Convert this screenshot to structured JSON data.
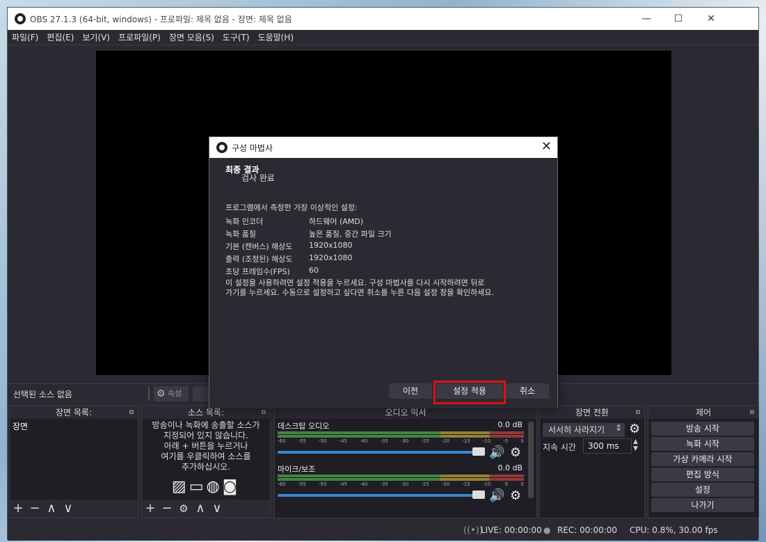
{
  "window": {
    "title": "OBS 27.1.3 (64-bit, windows) - 프로파일: 제목 없음 - 장면: 제목 없음"
  },
  "window_controls": {
    "minimize": "—",
    "maximize": "☐",
    "close": "✕"
  },
  "menu": [
    "파일(F)",
    "편집(E)",
    "보기(V)",
    "프로파일(P)",
    "장면 모음(S)",
    "도구(T)",
    "도움말(H)"
  ],
  "source_bar": {
    "selected": "선택된 소스 없음",
    "properties": "속성"
  },
  "docks": {
    "scenes": {
      "title": "장면 목록:",
      "items": [
        "장면"
      ]
    },
    "sources": {
      "title": "소스 목록:",
      "empty_lines": [
        "방송이나 녹화에 송출할 소스가",
        "지정되어 있지 않습니다.",
        "아래 + 버튼을 누르거나",
        "여기를 우클릭하여 소스를",
        "추가하십시오."
      ]
    },
    "mixer": {
      "title": "오디오 믹서",
      "scale": [
        "-60",
        "-55",
        "-50",
        "-45",
        "-40",
        "-35",
        "-30",
        "-25",
        "-20",
        "-15",
        "-10",
        "-5",
        "0"
      ],
      "channels": [
        {
          "name": "데스크탑 오디오",
          "db": "0.0 dB",
          "volume": 1.0
        },
        {
          "name": "마이크/보조",
          "db": "0.0 dB",
          "volume": 1.0
        }
      ]
    },
    "transitions": {
      "title": "장면 전환",
      "selected": "서서히 사라지기",
      "duration_label": "지속 시간",
      "duration": "300 ms"
    },
    "controls": {
      "title": "제어",
      "buttons": [
        "방송 시작",
        "녹화 시작",
        "가상 카메라 시작",
        "편집 방식",
        "설정",
        "나가기"
      ]
    }
  },
  "status": {
    "live": "LIVE: 00:00:00",
    "rec": "REC: 00:00:00",
    "cpu": "CPU: 0.8%, 30.00 fps"
  },
  "dialog": {
    "title": "구성 마법사",
    "heading": "최종 결과",
    "subheading": "검사 완료",
    "intro": "프로그램에서 측정한 가장 이상적인 설정:",
    "settings": [
      {
        "label": "녹화 인코더",
        "value": "하드웨어 (AMD)"
      },
      {
        "label": "녹화 품질",
        "value": "높은 품질, 중간 파일 크기"
      },
      {
        "label": "기본 (캔버스) 해상도",
        "value": "1920x1080"
      },
      {
        "label": "출력 (조정된) 해상도",
        "value": "1920x1080"
      },
      {
        "label": "초당 프레임수(FPS)",
        "value": "60"
      }
    ],
    "note_line1": "이 설정을 사용하려면 설정 적용을 누르세요. 구성 마법사를 다시 시작하려면 뒤로",
    "note_line2": "가기를 누르세요. 수동으로 설정하고 싶다면 취소를 누른 다음 설정 창을 확인하세요.",
    "buttons": {
      "back": "이전",
      "apply": "설정 적용",
      "cancel": "취소"
    }
  },
  "colors": {
    "highlight": "#e01010",
    "fader": "#3a86d4",
    "background": "#2b2a33"
  }
}
